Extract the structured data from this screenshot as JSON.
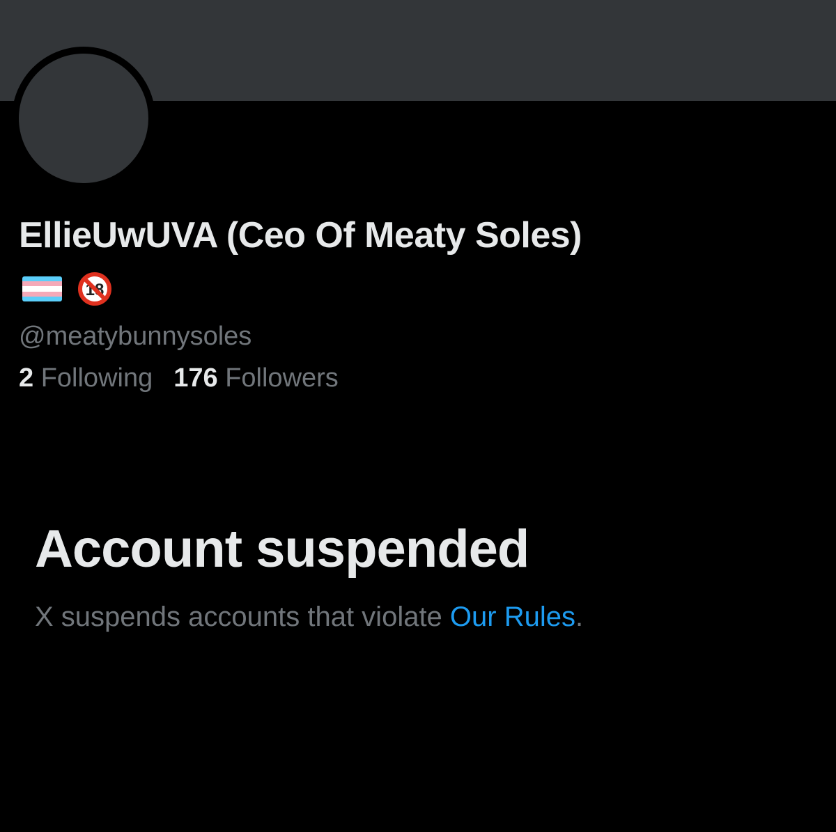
{
  "profile": {
    "display_name": "EllieUwUVA (Ceo Of Meaty Soles)",
    "name_emojis": [
      {
        "icon": "transgender-flag-icon",
        "stripes": [
          "#5bcefa",
          "#f5a9b8",
          "#ffffff",
          "#f5a9b8",
          "#5bcefa"
        ]
      },
      {
        "icon": "no-one-under-eighteen-icon",
        "text": "18"
      }
    ],
    "handle": "@meatybunnysoles",
    "following_count": "2",
    "following_label": "Following",
    "followers_count": "176",
    "followers_label": "Followers"
  },
  "notice": {
    "title": "Account suspended",
    "body_text": "X suspends accounts that violate ",
    "link_text": "Our Rules",
    "trailing": "."
  },
  "colors": {
    "background": "#000000",
    "banner": "#333639",
    "primary_text": "#e7e9ea",
    "secondary_text": "#71767b",
    "link": "#1d9bf0"
  }
}
